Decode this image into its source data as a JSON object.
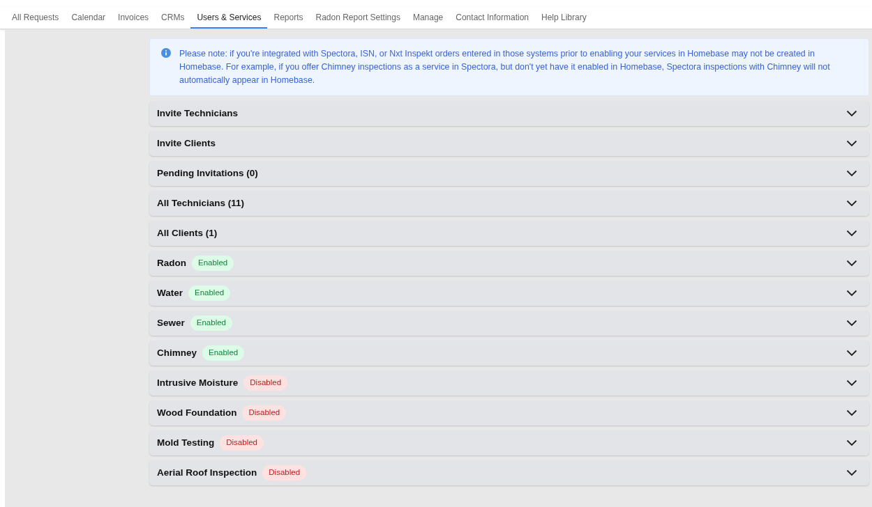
{
  "nav": [
    {
      "label": "All Requests",
      "selected": false
    },
    {
      "label": "Calendar",
      "selected": false
    },
    {
      "label": "Invoices",
      "selected": false
    },
    {
      "label": "CRMs",
      "selected": false
    },
    {
      "label": "Users & Services",
      "selected": true
    },
    {
      "label": "Reports",
      "selected": false
    },
    {
      "label": "Radon Report Settings",
      "selected": false
    },
    {
      "label": "Manage",
      "selected": false
    },
    {
      "label": "Contact Information",
      "selected": false
    },
    {
      "label": "Help Library",
      "selected": false
    }
  ],
  "notice": "Please note: if you're integrated with Spectora, ISN, or Nxt Inspekt orders entered in those systems prior to enabling your services in Homebase may not be created in Homebase. For example, if you offer Chimney inspections as a service in Spectora, but don't yet have it enabled in Homebase, Spectora inspections with Chimney will not automatically appear in Homebase.",
  "sections": [
    {
      "title": "Invite Technicians",
      "expanded": false
    },
    {
      "title": "Invite Clients",
      "expanded": false
    },
    {
      "title": "Pending Invitations (0)",
      "expanded": false
    },
    {
      "title": "All Technicians (11)",
      "expanded": false
    },
    {
      "title": "All Clients (1)",
      "expanded": false
    },
    {
      "title": "Radon",
      "expanded": false,
      "status": {
        "label": "Enabled",
        "kind": "enabled"
      }
    },
    {
      "title": "Water",
      "expanded": false,
      "status": {
        "label": "Enabled",
        "kind": "enabled"
      }
    },
    {
      "title": "Sewer",
      "expanded": false,
      "status": {
        "label": "Enabled",
        "kind": "enabled"
      }
    },
    {
      "title": "Chimney",
      "expanded": false,
      "status": {
        "label": "Enabled",
        "kind": "enabled"
      }
    },
    {
      "title": "Intrusive Moisture",
      "expanded": false,
      "status": {
        "label": "Disabled",
        "kind": "disabled"
      }
    },
    {
      "title": "Wood Foundation",
      "expanded": false,
      "status": {
        "label": "Disabled",
        "kind": "disabled"
      }
    },
    {
      "title": "Mold Testing",
      "expanded": false,
      "status": {
        "label": "Disabled",
        "kind": "disabled"
      }
    },
    {
      "title": "Aerial Roof Inspection",
      "expanded": false,
      "status": {
        "label": "Disabled",
        "kind": "disabled"
      }
    }
  ]
}
